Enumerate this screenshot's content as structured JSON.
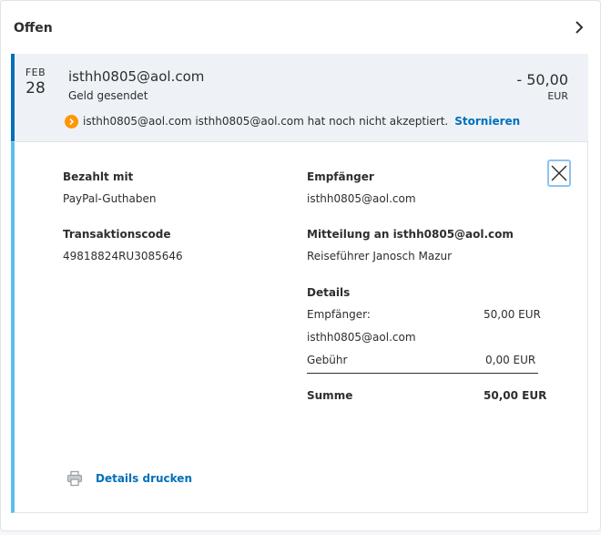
{
  "section": {
    "title": "Offen"
  },
  "transaction": {
    "month": "FEB",
    "day": "28",
    "name": "isthh0805@aol.com",
    "type": "Geld gesendet",
    "amount": "- 50,00",
    "currency": "EUR",
    "notice_text": "isthh0805@aol.com isthh0805@aol.com hat noch nicht akzeptiert.",
    "notice_link": "Stornieren"
  },
  "details": {
    "paid_with_label": "Bezahlt mit",
    "paid_with_value": "PayPal-Guthaben",
    "txn_code_label": "Transaktionscode",
    "txn_code_value": "49818824RU3085646",
    "recipient_label": "Empfänger",
    "recipient_value": "isthh0805@aol.com",
    "message_label": "Mitteilung an isthh0805@aol.com",
    "message_value": "Reiseführer Janosch Mazur",
    "breakdown_label": "Details",
    "breakdown": {
      "recipient_label": "Empfänger:",
      "recipient_amount": "50,00 EUR",
      "recipient_email": "isthh0805@aol.com",
      "fee_label": "Gebühr",
      "fee_amount": "0,00 EUR",
      "total_label": "Summe",
      "total_amount": "50,00 EUR"
    },
    "print_label": "Details drucken"
  },
  "colors": {
    "accent": "#0070ba",
    "warning": "#ff9600",
    "selected_border": "#5bbfe8"
  },
  "icons": [
    "chevron-right-icon",
    "warning-arrow-icon",
    "close-icon",
    "printer-icon"
  ]
}
